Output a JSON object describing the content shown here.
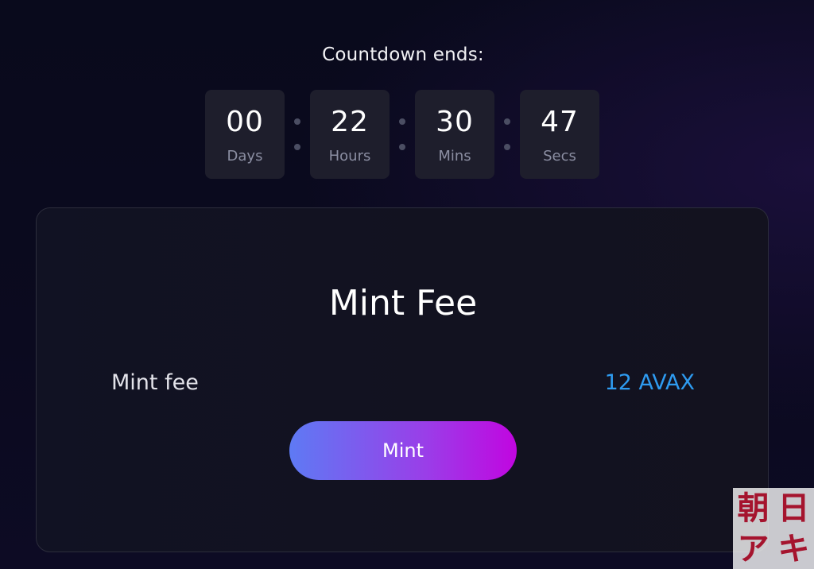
{
  "countdown": {
    "title": "Countdown ends:",
    "units": [
      {
        "value": "00",
        "label": "Days"
      },
      {
        "value": "22",
        "label": "Hours"
      },
      {
        "value": "30",
        "label": "Mins"
      },
      {
        "value": "47",
        "label": "Secs"
      }
    ]
  },
  "mint_card": {
    "title": "Mint Fee",
    "fee_label": "Mint fee",
    "fee_value": "12 AVAX",
    "button_label": "Mint"
  },
  "watermark": {
    "chars": [
      "朝",
      "日",
      "ア",
      "キ"
    ]
  },
  "colors": {
    "accent_blue": "#2e9bf0",
    "button_gradient_start": "#5e7af4",
    "button_gradient_end": "#c106e0",
    "background": "#0b0a1f"
  }
}
